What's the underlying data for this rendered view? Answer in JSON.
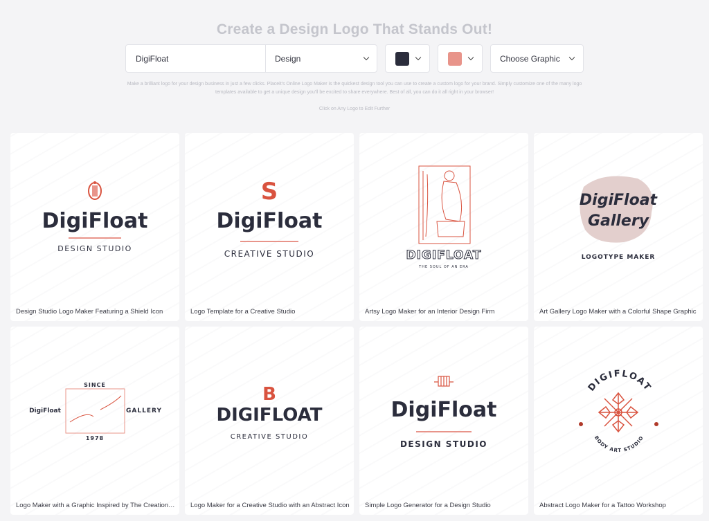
{
  "hero": {
    "title": "Create a Design Logo That Stands Out!"
  },
  "toolbar": {
    "name_value": "DigiFloat",
    "category_value": "Design",
    "color1": "#2b2d3c",
    "color2": "#e8948a",
    "graphic_label": "Choose Graphic"
  },
  "description": "Make a brilliant logo for your design business in just a few clicks. Placeit's Online Logo Maker is the quickest design tool you can use to create a custom logo for your brand. Simply customize one of the many logo templates available to get a unique design you'll be excited to share everywhere. Best of all, you can do it all right in your browser!",
  "hint": "Click on Any Logo to Edit Further",
  "accent": "#d9533f",
  "cards": [
    {
      "caption": "Design Studio Logo Maker Featuring a Shield Icon",
      "name": "DigiFloat",
      "sub": "DESIGN STUDIO"
    },
    {
      "caption": "Logo Template for a Creative Studio",
      "name": "DigiFloat",
      "sub": "CREATIVE STUDIO"
    },
    {
      "caption": "Artsy Logo Maker for an Interior Design Firm",
      "name": "DIGIFLOAT",
      "sub": "THE SOUL OF AN ERA"
    },
    {
      "caption": "Art Gallery Logo Maker with a Colorful Shape Graphic",
      "name": "DigiFloat Gallery",
      "sub": "LOGOTYPE MAKER"
    },
    {
      "caption": "Logo Maker with a Graphic Inspired by The Creation ...",
      "name": "DigiFloat",
      "sub": "GALLERY",
      "top": "SINCE",
      "year": "1978"
    },
    {
      "caption": "Logo Maker for a Creative Studio with an Abstract Icon",
      "name": "DIGIFLOAT",
      "sub": "CREATIVE STUDIO"
    },
    {
      "caption": "Simple Logo Generator for a Design Studio",
      "name": "DigiFloat",
      "sub": "DESIGN STUDIO"
    },
    {
      "caption": "Abstract Logo Maker for a Tattoo Workshop",
      "name": "DIGIFLOAT",
      "sub": "BODY ART STUDIO"
    }
  ]
}
